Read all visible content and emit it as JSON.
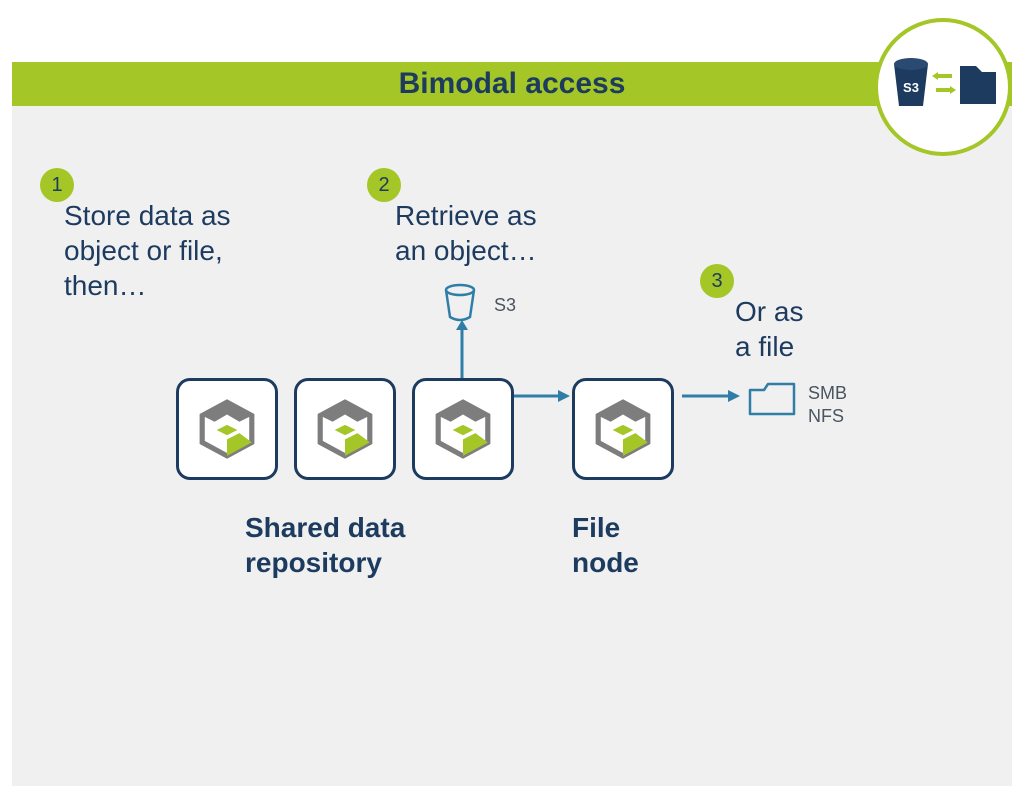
{
  "title": "Bimodal access",
  "steps": [
    {
      "num": "1",
      "text": "Store data as\nobject or file,\nthen…"
    },
    {
      "num": "2",
      "text": "Retrieve as\nan object…"
    },
    {
      "num": "3",
      "text": "Or as\na file"
    }
  ],
  "protocols": {
    "object": "S3",
    "file": "SMB\nNFS"
  },
  "captions": {
    "repo": "Shared data\nrepository",
    "filenode": "File\nnode"
  },
  "colors": {
    "accent": "#a4c626",
    "dark": "#1d3b5f",
    "line": "#2f7ea8"
  },
  "corner_icon": {
    "bucket_label": "S3"
  }
}
